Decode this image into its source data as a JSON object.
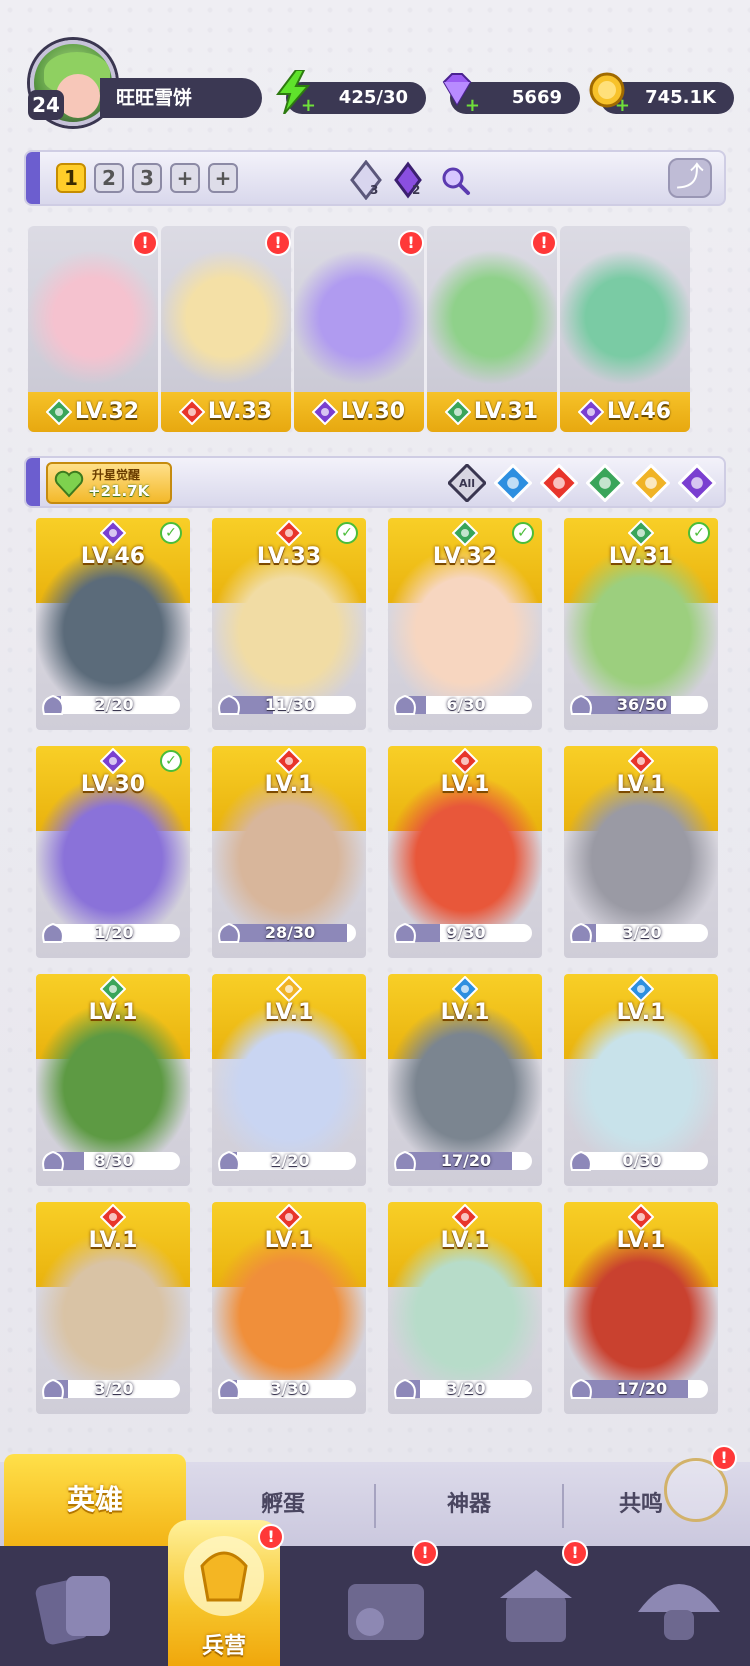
{
  "player": {
    "level": "24",
    "name": "旺旺雪饼"
  },
  "resources": {
    "energy": "425/30",
    "gems": "5669",
    "gold": "745.1K"
  },
  "team": {
    "tabs": [
      "1",
      "2",
      "3",
      "+",
      "+"
    ],
    "active_tab": "1",
    "counter_a": "3",
    "counter_b": "2",
    "share_icon": "share-icon"
  },
  "lineup": [
    {
      "level": "LV.32",
      "element": "wind",
      "alert": "!",
      "art": "#f5c2cf"
    },
    {
      "level": "LV.33",
      "element": "fire",
      "alert": "!",
      "art": "#f4e0a6"
    },
    {
      "level": "LV.30",
      "element": "dark",
      "alert": "!",
      "art": "#b09bf0"
    },
    {
      "level": "LV.31",
      "element": "wind",
      "alert": "!",
      "art": "#8fd18a"
    },
    {
      "level": "LV.46",
      "element": "dark",
      "alert": "",
      "art": "#7acba4"
    }
  ],
  "filter": {
    "awaken_title": "升星觉醒",
    "awaken_value": "+21.7K",
    "all_label": "All",
    "elements": [
      "water",
      "fire",
      "wind",
      "light",
      "dark"
    ]
  },
  "heroes": [
    {
      "level": "LV.46",
      "element": "dark",
      "checked": true,
      "frag": "2/20",
      "progress": 0.1,
      "art": "#5b6b7a"
    },
    {
      "level": "LV.33",
      "element": "fire",
      "checked": true,
      "frag": "11/30",
      "progress": 0.37,
      "art": "#f1dca4"
    },
    {
      "level": "LV.32",
      "element": "wind",
      "checked": true,
      "frag": "6/30",
      "progress": 0.2,
      "art": "#f7d6c0"
    },
    {
      "level": "LV.31",
      "element": "wind",
      "checked": true,
      "frag": "36/50",
      "progress": 0.72,
      "art": "#9ccf7e"
    },
    {
      "level": "LV.30",
      "element": "dark",
      "checked": true,
      "frag": "1/20",
      "progress": 0.05,
      "art": "#8a72d9"
    },
    {
      "level": "LV.1",
      "element": "fire",
      "checked": false,
      "frag": "28/30",
      "progress": 0.93,
      "art": "#d8b69b"
    },
    {
      "level": "LV.1",
      "element": "fire",
      "checked": false,
      "frag": "9/30",
      "progress": 0.3,
      "art": "#e8573a"
    },
    {
      "level": "LV.1",
      "element": "fire",
      "checked": false,
      "frag": "3/20",
      "progress": 0.15,
      "art": "#9a9aa4"
    },
    {
      "level": "LV.1",
      "element": "wind",
      "checked": false,
      "frag": "8/30",
      "progress": 0.27,
      "art": "#5d9a43"
    },
    {
      "level": "LV.1",
      "element": "light",
      "checked": false,
      "frag": "2/20",
      "progress": 0.1,
      "art": "#c9d5f2"
    },
    {
      "level": "LV.1",
      "element": "water",
      "checked": false,
      "frag": "17/20",
      "progress": 0.85,
      "art": "#7b8590"
    },
    {
      "level": "LV.1",
      "element": "water",
      "checked": false,
      "frag": "0/30",
      "progress": 0.0,
      "art": "#c8e2ea"
    },
    {
      "level": "LV.1",
      "element": "fire",
      "checked": false,
      "frag": "3/20",
      "progress": 0.15,
      "art": "#d9c3a5"
    },
    {
      "level": "LV.1",
      "element": "fire",
      "checked": false,
      "frag": "3/30",
      "progress": 0.1,
      "art": "#f08f3a"
    },
    {
      "level": "LV.1",
      "element": "fire",
      "checked": false,
      "frag": "3/20",
      "progress": 0.15,
      "art": "#b7dcc9"
    },
    {
      "level": "LV.1",
      "element": "fire",
      "checked": false,
      "frag": "17/20",
      "progress": 0.85,
      "art": "#c9412f"
    }
  ],
  "subtabs": {
    "hero": "英雄",
    "hatch": "孵蛋",
    "artifact": "神器",
    "resonance": "共鸣",
    "resonance_alert": "!"
  },
  "nav": {
    "items": [
      "cards-icon",
      "barracks-icon",
      "book-icon",
      "shrine-icon",
      "mushroom-icon"
    ],
    "active_label": "兵营",
    "alert": "!"
  },
  "colors": {
    "fire": "#e8352b",
    "water": "#2d8fe0",
    "wind": "#3aa55a",
    "light": "#f0b326",
    "dark": "#7a3fd0",
    "accent": "#6c5ecf"
  }
}
